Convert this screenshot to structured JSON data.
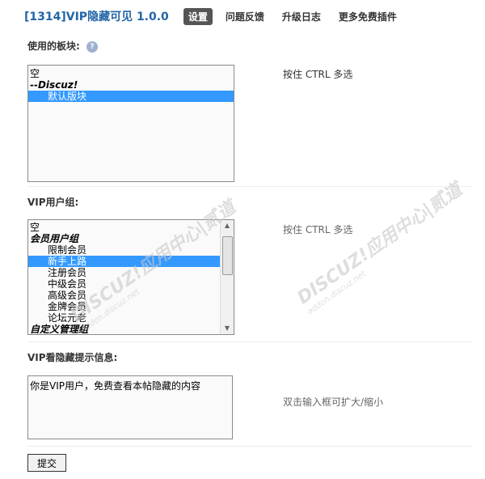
{
  "header": {
    "title": "[1314]VIP隐藏可见  1.0.0",
    "tabs": [
      {
        "label": "设置",
        "active": true
      },
      {
        "label": "问题反馈",
        "active": false
      },
      {
        "label": "升级日志",
        "active": false
      },
      {
        "label": "更多免费插件",
        "active": false
      }
    ]
  },
  "boards": {
    "label": "使用的板块:",
    "help_icon": "help-icon",
    "options": [
      {
        "text": "空",
        "type": "plain",
        "selected": false
      },
      {
        "text": "--Discuz!",
        "type": "group",
        "selected": false
      },
      {
        "text": "默认版块",
        "type": "indent",
        "selected": true
      }
    ],
    "hint": "按住 CTRL 多选"
  },
  "vip_groups": {
    "label": "VIP用户组:",
    "options": [
      {
        "text": "空",
        "type": "plain",
        "selected": false
      },
      {
        "text": "会员用户组",
        "type": "group",
        "selected": false
      },
      {
        "text": "限制会员",
        "type": "indent",
        "selected": false
      },
      {
        "text": "新手上路",
        "type": "indent",
        "selected": true
      },
      {
        "text": "注册会员",
        "type": "indent",
        "selected": false
      },
      {
        "text": "中级会员",
        "type": "indent",
        "selected": false
      },
      {
        "text": "高级会员",
        "type": "indent",
        "selected": false
      },
      {
        "text": "金牌会员",
        "type": "indent",
        "selected": false
      },
      {
        "text": "论坛元老",
        "type": "indent",
        "selected": false
      },
      {
        "text": "自定义管理组",
        "type": "group",
        "selected": false
      }
    ],
    "hint": "按住 CTRL 多选"
  },
  "vip_message": {
    "label": "VIP看隐藏提示信息:",
    "value": "你是VIP用户，免费查看本帖隐藏的内容",
    "hint": "双击输入框可扩大/缩小"
  },
  "submit_label": "提交",
  "watermark": {
    "main": "DISCUZ!应用中心|贰道",
    "sub": "addon.discuz.net"
  }
}
